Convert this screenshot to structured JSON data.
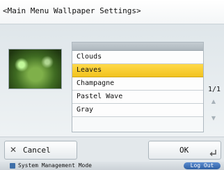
{
  "header": {
    "title": "<Main Menu Wallpaper Settings>"
  },
  "wallpaper_list": {
    "items": [
      {
        "label": "Clouds"
      },
      {
        "label": "Leaves"
      },
      {
        "label": "Champagne"
      },
      {
        "label": "Pastel Wave"
      },
      {
        "label": "Gray"
      }
    ],
    "selected": "Leaves",
    "page_indicator": "1/1"
  },
  "preview": {
    "wallpaper": "Leaves"
  },
  "footer": {
    "cancel_label": "Cancel",
    "ok_label": "OK"
  },
  "status_bar": {
    "mode_text": "System Management Mode",
    "logout_label": "Log Out"
  },
  "colors": {
    "selected_row": "#f2c31e",
    "logout_button": "#2e5fa3",
    "status_icon": "#3f6fa8"
  },
  "icons": {
    "cancel": "close-icon",
    "ok": "return-icon",
    "scroll_up": "arrow-up-icon",
    "scroll_down": "arrow-down-icon",
    "status": "id-card-icon"
  }
}
